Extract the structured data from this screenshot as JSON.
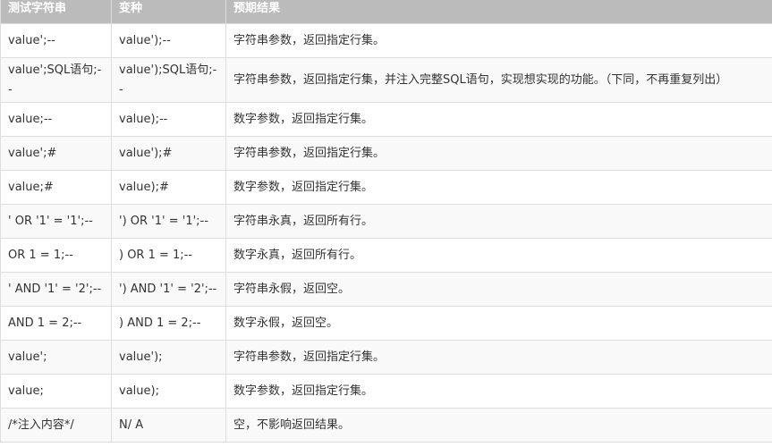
{
  "table": {
    "headers": [
      "测试字符串",
      "变种",
      "预期结果"
    ],
    "rows": [
      [
        "value';--",
        "value');--",
        "字符串参数，返回指定行集。"
      ],
      [
        "value';SQL语句;--",
        "value');SQL语句;--",
        "字符串参数，返回指定行集，并注入完整SQL语句，实现想实现的功能。（下同，不再重复列出）"
      ],
      [
        "value;--",
        "value);--",
        "数字参数，返回指定行集。"
      ],
      [
        "value';#",
        "value');#",
        "字符串参数，返回指定行集。"
      ],
      [
        "value;#",
        "value);#",
        "数字参数，返回指定行集。"
      ],
      [
        "' OR '1' = '1';--",
        "') OR '1' = '1';--",
        "字符串永真，返回所有行。"
      ],
      [
        " OR 1 = 1;--",
        ") OR 1 = 1;--",
        "数字永真，返回所有行。"
      ],
      [
        "' AND '1' = '2';--",
        "') AND '1' = '2';--",
        "字符串永假，返回空。"
      ],
      [
        " AND 1 = 2;--",
        ") AND 1 = 2;--",
        "数字永假，返回空。"
      ],
      [
        "value';",
        "value');",
        "字符串参数，返回指定行集。"
      ],
      [
        "value;",
        "value);",
        "数字参数，返回指定行集。"
      ],
      [
        "/*注入内容*/",
        "N/ A",
        "空，不影响返回结果。"
      ]
    ]
  }
}
